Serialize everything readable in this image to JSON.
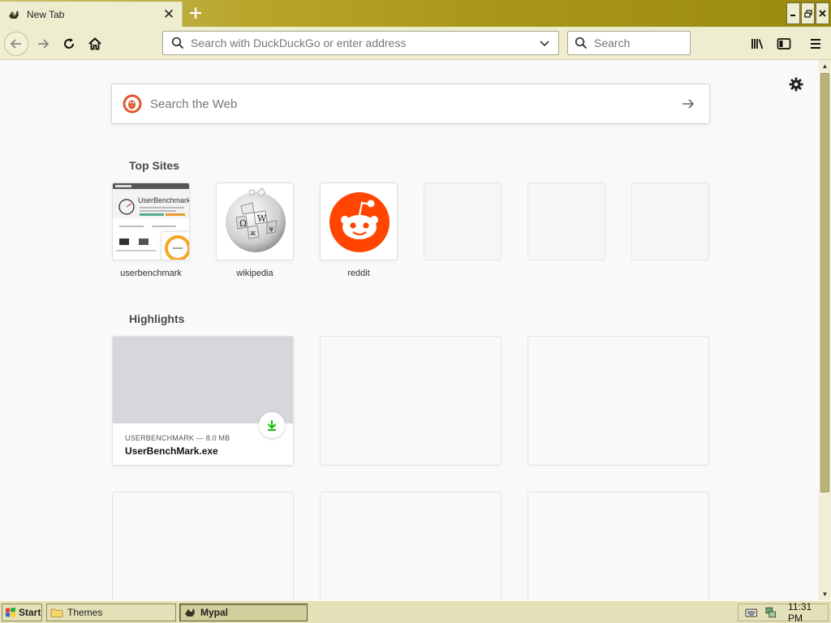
{
  "browser": {
    "tab": {
      "title": "New Tab"
    },
    "urlbar": {
      "placeholder": "Search with DuckDuckGo or enter address"
    },
    "searchbar": {
      "placeholder": "Search"
    }
  },
  "newtab": {
    "web_search": {
      "placeholder": "Search the Web"
    },
    "top_sites": {
      "title": "Top Sites",
      "sites": [
        {
          "label": "userbenchmark",
          "icon": "userbenchmark-thumbnail"
        },
        {
          "label": "wikipedia",
          "icon": "wikipedia-globe-icon"
        },
        {
          "label": "reddit",
          "icon": "reddit-snoo-icon"
        },
        {
          "label": "",
          "icon": ""
        },
        {
          "label": "",
          "icon": ""
        },
        {
          "label": "",
          "icon": ""
        }
      ]
    },
    "highlights": {
      "title": "Highlights",
      "cards": [
        {
          "meta": "USERBENCHMARK — 8.0 MB",
          "title": "UserBenchMark.exe",
          "icon": "download-icon"
        }
      ]
    }
  },
  "taskbar": {
    "start_label": "Start",
    "tasks": [
      {
        "label": "Themes",
        "icon": "folder-icon"
      },
      {
        "label": "Mypal",
        "icon": "mypal-icon"
      }
    ],
    "clock": "11:31 PM"
  },
  "colors": {
    "chrome": "#efedcf",
    "title_gradient_end": "#9a8a10",
    "reddit_orange": "#ff4500",
    "download_green": "#12bc00",
    "ddg_orange": "#de5833"
  }
}
